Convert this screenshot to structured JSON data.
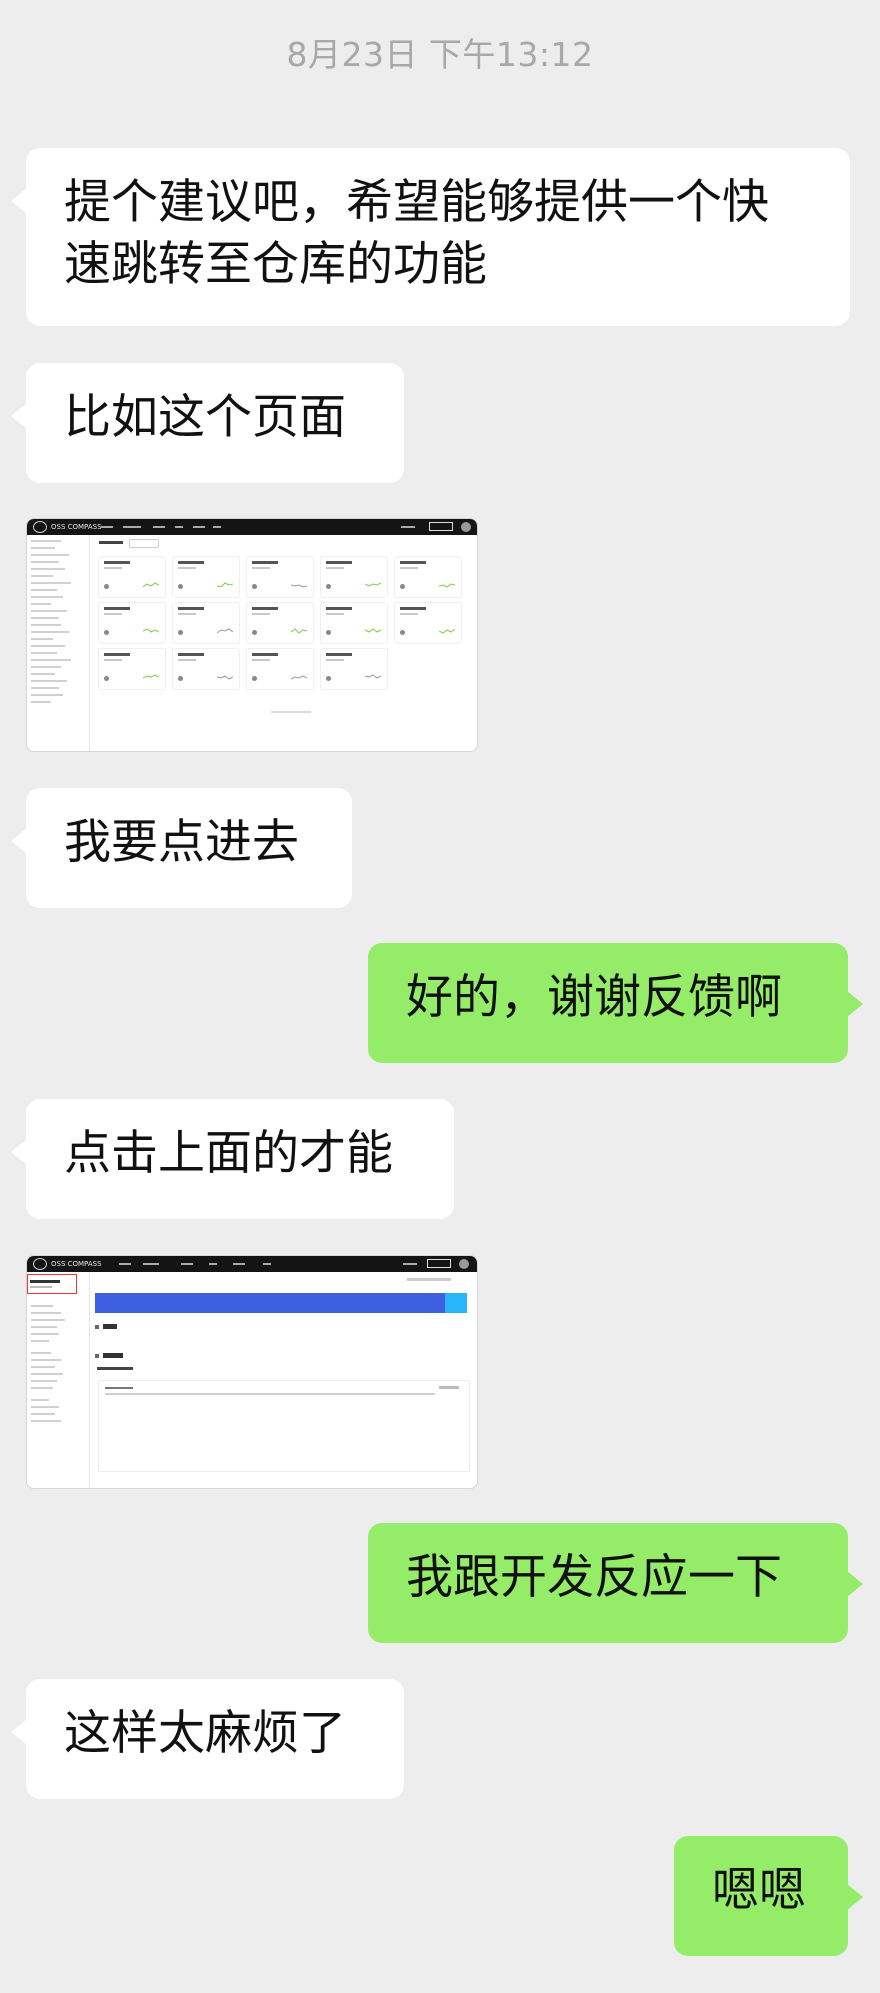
{
  "chat": {
    "timestamp": "8月23日 下午13:12",
    "messages": [
      {
        "from": "other",
        "type": "text",
        "text": "提个建议吧，希望能够提供一个快速跳转至仓库的功能"
      },
      {
        "from": "other",
        "type": "text",
        "text": "比如这个页面"
      },
      {
        "from": "other",
        "type": "image",
        "brand": "OSS COMPASS"
      },
      {
        "from": "other",
        "type": "text",
        "text": "我要点进去"
      },
      {
        "from": "self",
        "type": "text",
        "text": "好的，谢谢反馈啊"
      },
      {
        "from": "other",
        "type": "text",
        "text": "点击上面的才能"
      },
      {
        "from": "other",
        "type": "image",
        "brand": "OSS COMPASS"
      },
      {
        "from": "self",
        "type": "text",
        "text": "我跟开发反应一下"
      },
      {
        "from": "other",
        "type": "text",
        "text": "这样太麻烦了"
      },
      {
        "from": "self",
        "type": "text",
        "text": "嗯嗯"
      }
    ]
  },
  "colors": {
    "background": "#ededed",
    "incoming_bubble": "#ffffff",
    "outgoing_bubble": "#95ec69",
    "timestamp": "#a8a8a8",
    "screenshot_banner": "#3d5fe0"
  }
}
